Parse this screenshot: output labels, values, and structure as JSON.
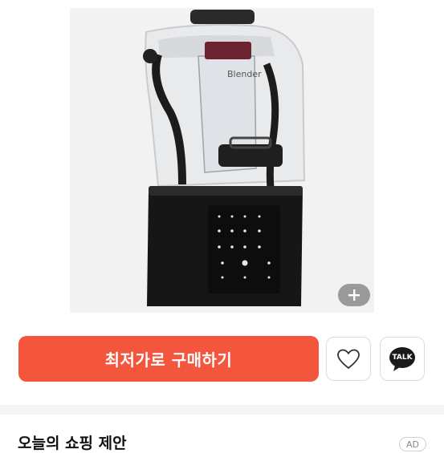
{
  "product": {
    "image_icon": "blender-product-image",
    "brand_text": "Blender"
  },
  "actions": {
    "buy_label": "최저가로 구매하기",
    "wishlist_icon": "heart-icon",
    "share_label": "TALK",
    "share_icon": "kakao-talk-icon",
    "zoom_icon": "plus-icon"
  },
  "recommendation": {
    "title": "오늘의 쇼핑 제안",
    "ad_label": "AD"
  },
  "colors": {
    "buy_button": "#f4553d",
    "image_bg": "#f2f2f2"
  }
}
